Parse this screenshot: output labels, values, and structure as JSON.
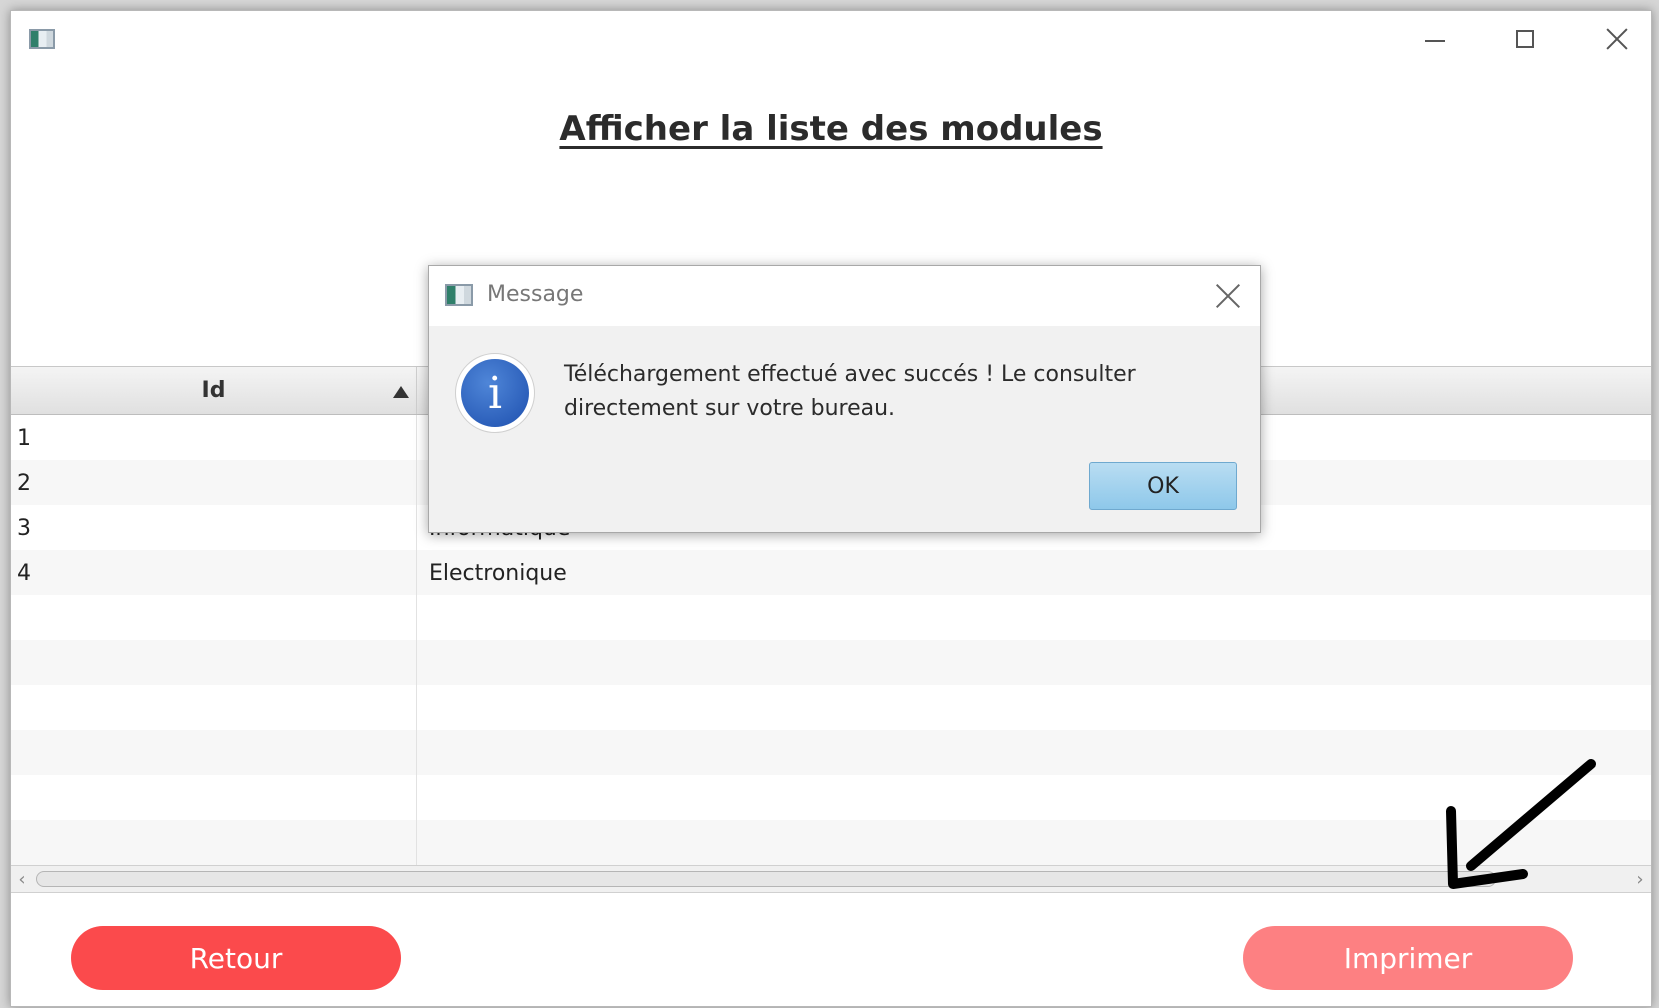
{
  "window": {
    "title_icon": "app-window-icon",
    "controls": {
      "minimize": "minimize-icon",
      "maximize": "maximize-icon",
      "close": "close-icon"
    }
  },
  "page": {
    "title": "Afficher la liste des modules"
  },
  "table": {
    "columns": [
      "Id",
      ""
    ],
    "sort": {
      "column": "Id",
      "direction": "ascending"
    },
    "rows": [
      {
        "id": "1",
        "name": ""
      },
      {
        "id": "2",
        "name": ""
      },
      {
        "id": "3",
        "name": "Informatique"
      },
      {
        "id": "4",
        "name": "Electronique"
      }
    ]
  },
  "buttons": {
    "back": "Retour",
    "print": "Imprimer"
  },
  "dialog": {
    "title": "Message",
    "icon": "info-icon",
    "message": "Téléchargement effectué avec succés ! Le consulter directement sur votre bureau.",
    "ok_label": "OK"
  },
  "colors": {
    "back_button": "#fb4a4c",
    "print_button": "#fd8082",
    "ok_button": "#a6d3ee",
    "info_icon": "#2a5fbf"
  }
}
